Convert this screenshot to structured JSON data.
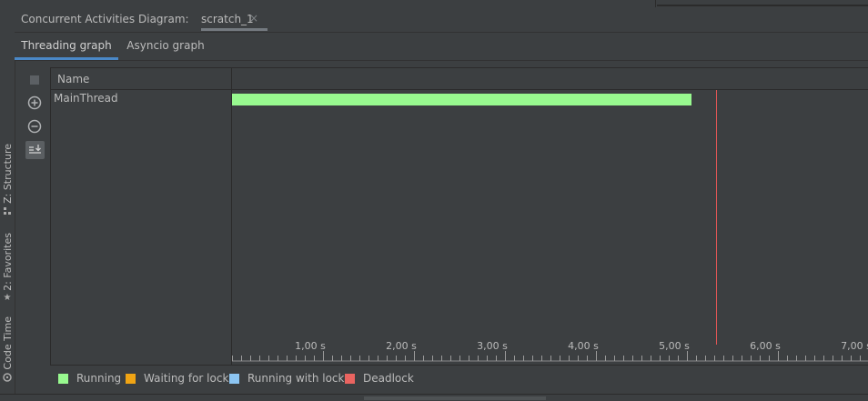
{
  "colors": {
    "running": "#98f98f",
    "waiting_for_lock": "#f0a414",
    "running_with_lock": "#8cc5f2",
    "deadlock": "#ea6460",
    "marker": "#e05555",
    "accent": "#4a88c7"
  },
  "sidebar": {
    "items": [
      {
        "label": "Z: Structure",
        "icon": "structure-icon"
      },
      {
        "label": "2: Favorites",
        "icon": "star-icon"
      },
      {
        "label": "Code Time",
        "icon": "clock-icon"
      }
    ]
  },
  "header": {
    "title": "Concurrent Activities Diagram:",
    "file_tab": {
      "label": "scratch_1",
      "close": "×"
    }
  },
  "tabs": [
    {
      "label": "Threading graph",
      "active": true
    },
    {
      "label": "Asyncio graph",
      "active": false
    }
  ],
  "toolbar": {
    "items": [
      {
        "icon": "stop-icon",
        "enabled": false
      },
      {
        "icon": "zoom-in-icon",
        "enabled": true
      },
      {
        "icon": "zoom-out-icon",
        "enabled": true
      },
      {
        "icon": "scroll-to-end-icon",
        "enabled": true,
        "toggled": true
      }
    ]
  },
  "table": {
    "name_header": "Name"
  },
  "timeline": {
    "seconds_per_major_tick": 1,
    "tick_labels": [
      "1,00 s",
      "2,00 s",
      "3,00 s",
      "4,00 s",
      "5,00 s",
      "6,00 s",
      "7,00 s"
    ],
    "threads": [
      {
        "name": "MainThread",
        "segments": [
          {
            "state": "running",
            "start_s": 0,
            "end_s": 5.05
          }
        ]
      }
    ],
    "current_time_s": 5.32
  },
  "legend": [
    {
      "label": "Running",
      "state": "running"
    },
    {
      "label": "Waiting for lock",
      "state": "waiting_for_lock"
    },
    {
      "label": "Running with lock",
      "state": "running_with_lock"
    },
    {
      "label": "Deadlock",
      "state": "deadlock"
    }
  ]
}
